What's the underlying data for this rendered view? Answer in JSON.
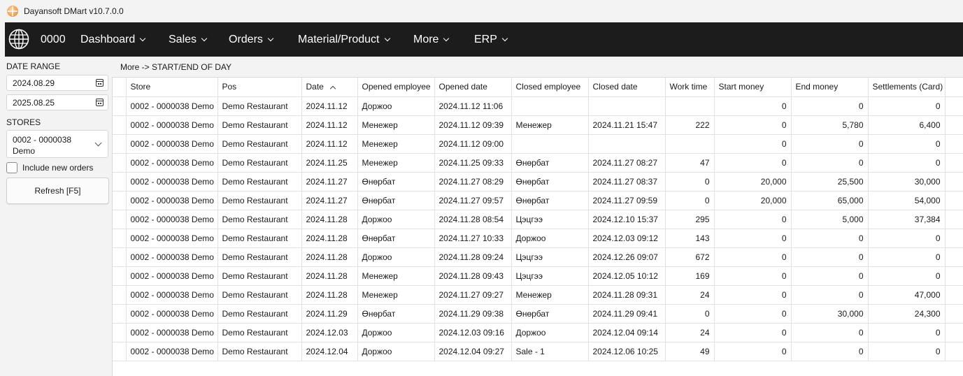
{
  "window": {
    "title": "Dayansoft DMart v10.7.0.0"
  },
  "nav": {
    "store_code": "0000",
    "items": [
      {
        "label": "Dashboard"
      },
      {
        "label": "Sales"
      },
      {
        "label": "Orders"
      },
      {
        "label": "Material/Product"
      },
      {
        "label": "More"
      },
      {
        "label": "ERP"
      }
    ]
  },
  "sidebar": {
    "date_range_label": "DATE RANGE",
    "date_from": "2024.08.29",
    "date_to": "2025.08.25",
    "stores_label": "STORES",
    "store_selected": "0002 - 0000038 Demo",
    "include_new_orders_label": "Include new orders",
    "include_new_orders_checked": false,
    "refresh_label": "Refresh [F5]"
  },
  "breadcrumb": "More -> START/END OF DAY",
  "grid": {
    "columns": [
      "Store",
      "Pos",
      "Date",
      "Opened employee",
      "Opened date",
      "Closed employee",
      "Closed date",
      "Work time",
      "Start money",
      "End money",
      "Settlements (Card)"
    ],
    "sorted_column": "Date",
    "rows": [
      [
        "0002 - 0000038 Demo",
        "Demo Restaurant",
        "2024.11.12",
        "Доржоо",
        "2024.11.12 11:06",
        "",
        "",
        "",
        "0",
        "0",
        "0"
      ],
      [
        "0002 - 0000038 Demo",
        "Demo Restaurant",
        "2024.11.12",
        "Менежер",
        "2024.11.12 09:39",
        "Менежер",
        "2024.11.21 15:47",
        "222",
        "0",
        "5,780",
        "6,400"
      ],
      [
        "0002 - 0000038 Demo",
        "Demo Restaurant",
        "2024.11.12",
        "Менежер",
        "2024.11.12 09:00",
        "",
        "",
        "",
        "0",
        "0",
        "0"
      ],
      [
        "0002 - 0000038 Demo",
        "Demo Restaurant",
        "2024.11.25",
        "Менежер",
        "2024.11.25 09:33",
        "Өнөрбат",
        "2024.11.27 08:27",
        "47",
        "0",
        "0",
        "0"
      ],
      [
        "0002 - 0000038 Demo",
        "Demo Restaurant",
        "2024.11.27",
        "Өнөрбат",
        "2024.11.27 08:29",
        "Өнөрбат",
        "2024.11.27 08:37",
        "0",
        "20,000",
        "25,500",
        "30,000"
      ],
      [
        "0002 - 0000038 Demo",
        "Demo Restaurant",
        "2024.11.27",
        "Өнөрбат",
        "2024.11.27 09:57",
        "Өнөрбат",
        "2024.11.27 09:59",
        "0",
        "20,000",
        "65,000",
        "54,000"
      ],
      [
        "0002 - 0000038 Demo",
        "Demo Restaurant",
        "2024.11.28",
        "Доржоо",
        "2024.11.28 08:54",
        "Цэцгээ",
        "2024.12.10 15:37",
        "295",
        "0",
        "5,000",
        "37,384"
      ],
      [
        "0002 - 0000038 Demo",
        "Demo Restaurant",
        "2024.11.28",
        "Өнөрбат",
        "2024.11.27 10:33",
        "Доржоо",
        "2024.12.03 09:12",
        "143",
        "0",
        "0",
        "0"
      ],
      [
        "0002 - 0000038 Demo",
        "Demo Restaurant",
        "2024.11.28",
        "Доржоо",
        "2024.11.28 09:24",
        "Цэцгээ",
        "2024.12.26 09:07",
        "672",
        "0",
        "0",
        "0"
      ],
      [
        "0002 - 0000038 Demo",
        "Demo Restaurant",
        "2024.11.28",
        "Менежер",
        "2024.11.28 09:43",
        "Цэцгээ",
        "2024.12.05 10:12",
        "169",
        "0",
        "0",
        "0"
      ],
      [
        "0002 - 0000038 Demo",
        "Demo Restaurant",
        "2024.11.28",
        "Менежер",
        "2024.11.27 09:27",
        "Менежер",
        "2024.11.28 09:31",
        "24",
        "0",
        "0",
        "47,000"
      ],
      [
        "0002 - 0000038 Demo",
        "Demo Restaurant",
        "2024.11.29",
        "Өнөрбат",
        "2024.11.29 09:38",
        "Өнөрбат",
        "2024.11.29 09:41",
        "0",
        "0",
        "30,000",
        "24,300"
      ],
      [
        "0002 - 0000038 Demo",
        "Demo Restaurant",
        "2024.12.03",
        "Доржоо",
        "2024.12.03 09:16",
        "Доржоо",
        "2024.12.04 09:14",
        "24",
        "0",
        "0",
        "0"
      ],
      [
        "0002 - 0000038 Demo",
        "Demo Restaurant",
        "2024.12.04",
        "Доржоо",
        "2024.12.04 09:27",
        "Sale - 1",
        "2024.12.06 10:25",
        "49",
        "0",
        "0",
        "0"
      ]
    ]
  }
}
